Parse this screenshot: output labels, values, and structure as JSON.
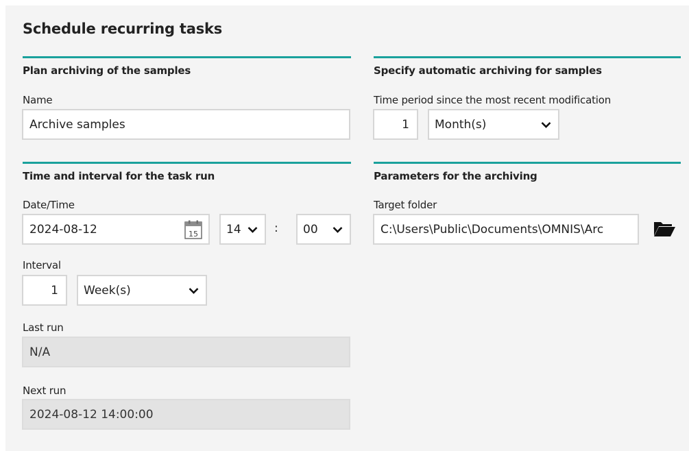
{
  "page": {
    "title": "Schedule recurring tasks"
  },
  "plan": {
    "heading": "Plan archiving of the samples",
    "name_label": "Name",
    "name_value": "Archive samples"
  },
  "time": {
    "heading": "Time and interval for the task run",
    "datetime_label": "Date/Time",
    "date_value": "2024-08-12",
    "calendar_day": "15",
    "hour_value": "14",
    "separator": ":",
    "minute_value": "00",
    "interval_label": "Interval",
    "interval_value": "1",
    "interval_unit": "Week(s)",
    "last_run_label": "Last run",
    "last_run_value": "N/A",
    "next_run_label": "Next run",
    "next_run_value": "2024-08-12 14:00:00"
  },
  "auto": {
    "heading": "Specify automatic archiving for samples",
    "period_label": "Time period since the most recent modification",
    "period_value": "1",
    "period_unit": "Month(s)"
  },
  "params": {
    "heading": "Parameters for the archiving",
    "target_label": "Target folder",
    "target_value": "C:\\Users\\Public\\Documents\\OMNIS\\Arc"
  },
  "colors": {
    "accent": "#1aa19c",
    "field_border": "#d6d6d6",
    "readonly_bg": "#e3e3e3"
  },
  "icons": [
    "calendar-icon",
    "chevron-down-icon",
    "folder-open-icon"
  ]
}
